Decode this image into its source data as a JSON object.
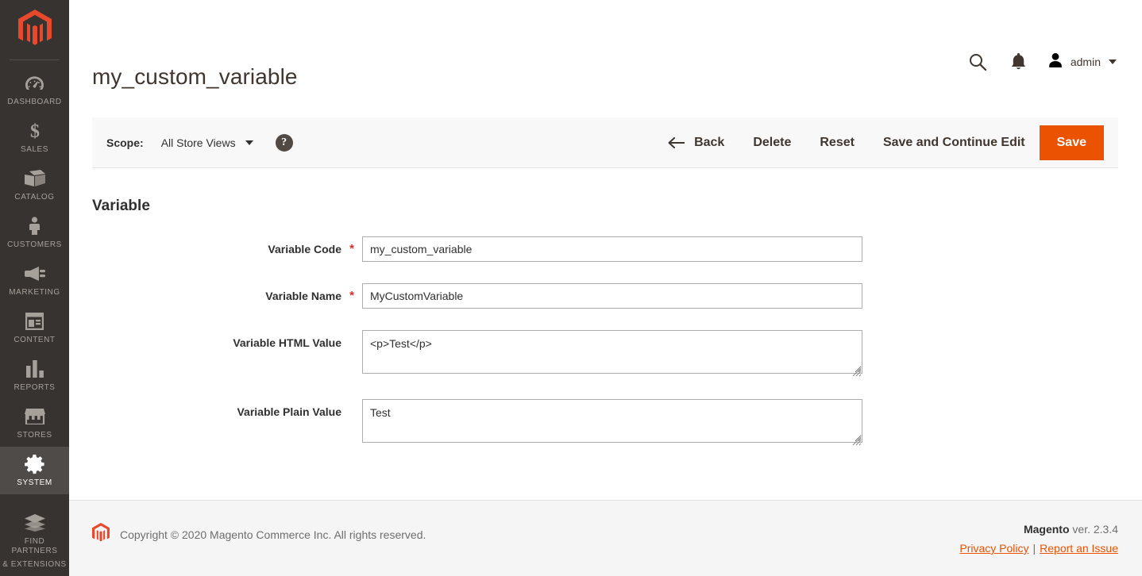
{
  "sidebar": {
    "logo": "magento-logo",
    "items": [
      {
        "label": "DASHBOARD",
        "icon": "dashboard-icon",
        "active": false
      },
      {
        "label": "SALES",
        "icon": "sales-icon",
        "active": false
      },
      {
        "label": "CATALOG",
        "icon": "catalog-icon",
        "active": false
      },
      {
        "label": "CUSTOMERS",
        "icon": "customers-icon",
        "active": false
      },
      {
        "label": "MARKETING",
        "icon": "marketing-icon",
        "active": false
      },
      {
        "label": "CONTENT",
        "icon": "content-icon",
        "active": false
      },
      {
        "label": "REPORTS",
        "icon": "reports-icon",
        "active": false
      },
      {
        "label": "STORES",
        "icon": "stores-icon",
        "active": false
      },
      {
        "label": "SYSTEM",
        "icon": "gear-icon",
        "active": true
      }
    ],
    "partners": {
      "line1": "FIND PARTNERS",
      "line2": "& EXTENSIONS",
      "icon": "extensions-icon"
    }
  },
  "header": {
    "title": "my_custom_variable",
    "search_icon": "search-icon",
    "notifications_icon": "bell-icon",
    "user": {
      "avatar_icon": "user-avatar-icon",
      "name": "admin",
      "caret": "chevron-down-icon"
    }
  },
  "toolbar": {
    "scope_label": "Scope:",
    "scope_value": "All Store Views",
    "help_icon_text": "?",
    "back_label": "Back",
    "back_icon": "arrow-left-icon",
    "delete_label": "Delete",
    "reset_label": "Reset",
    "save_continue_label": "Save and Continue Edit",
    "save_label": "Save"
  },
  "form": {
    "section_title": "Variable",
    "fields": [
      {
        "label": "Variable Code",
        "required": true,
        "type": "text",
        "value": "my_custom_variable",
        "placeholder": ""
      },
      {
        "label": "Variable Name",
        "required": true,
        "type": "text",
        "value": "MyCustomVariable",
        "placeholder": ""
      },
      {
        "label": "Variable HTML Value",
        "required": false,
        "type": "textarea",
        "value": "<p>Test</p>",
        "placeholder": ""
      },
      {
        "label": "Variable Plain Value",
        "required": false,
        "type": "textarea",
        "value": "Test",
        "placeholder": ""
      }
    ]
  },
  "footer": {
    "logo": "magento-logo-small",
    "copyright": "Copyright © 2020 Magento Commerce Inc. All rights reserved.",
    "brand": "Magento",
    "version": " ver. 2.3.4",
    "privacy_link": "Privacy Policy",
    "separator": "|",
    "report_link": "Report an Issue"
  },
  "colors": {
    "accent": "#eb5202",
    "sidebar_bg": "#373330",
    "sidebar_active": "#4e4b48",
    "required": "#e02b27",
    "toolbar_bg": "#f8f8f8",
    "footer_bg": "#f5f5f5",
    "text": "#303030"
  }
}
